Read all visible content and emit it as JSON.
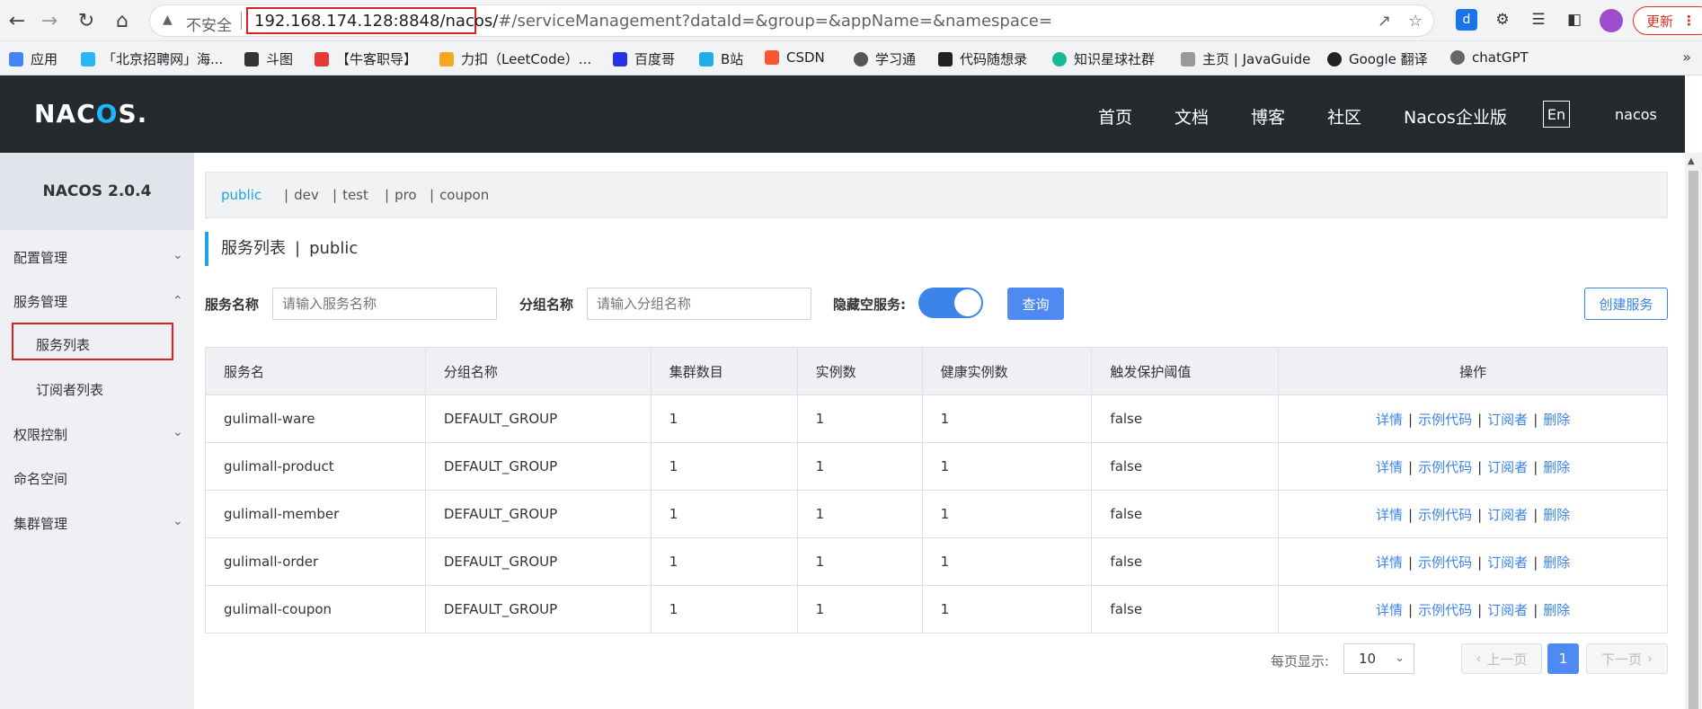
{
  "browser": {
    "insecure_label": "不安全",
    "url_highlight": "192.168.174.128:8848/nacos/",
    "url_rest": "#/serviceManagement?dataId=&group=&appName=&namespace=",
    "update_label": "更新",
    "bookmarks": [
      {
        "label": "应用",
        "color": "#4285f4"
      },
      {
        "label": "「北京招聘网」海...",
        "color": "#29b6f6"
      },
      {
        "label": "斗图",
        "color": "#333333"
      },
      {
        "label": "【牛客职导】",
        "color": "#e53935"
      },
      {
        "label": "力扣（LeetCode）...",
        "color": "#f5a623"
      },
      {
        "label": "百度哥",
        "color": "#2932e1"
      },
      {
        "label": "B站",
        "color": "#23ade5"
      },
      {
        "label": "CSDN",
        "color": "#fc5531"
      },
      {
        "label": "学习通",
        "color": "#555555"
      },
      {
        "label": "代码随想录",
        "color": "#222222"
      },
      {
        "label": "知识星球社群",
        "color": "#16b998"
      },
      {
        "label": "主页 | JavaGuide",
        "color": "#999999"
      },
      {
        "label": "Google 翻译",
        "color": "#222222"
      },
      {
        "label": "chatGPT",
        "color": "#666666"
      }
    ]
  },
  "header": {
    "logo": "NACOS.",
    "nav": [
      "首页",
      "文档",
      "博客",
      "社区",
      "Nacos企业版"
    ],
    "lang": "En",
    "user": "nacos"
  },
  "sidebar": {
    "version": "NACOS 2.0.4",
    "items": [
      {
        "label": "配置管理"
      },
      {
        "label": "服务管理"
      },
      {
        "label": "服务列表"
      },
      {
        "label": "订阅者列表"
      },
      {
        "label": "权限控制"
      },
      {
        "label": "命名空间"
      },
      {
        "label": "集群管理"
      }
    ]
  },
  "namespaces": [
    "public",
    "dev",
    "test",
    "pro",
    "coupon"
  ],
  "page": {
    "title": "服务列表",
    "title_sep": "|",
    "namespace": "public"
  },
  "filters": {
    "service_label": "服务名称",
    "service_placeholder": "请输入服务名称",
    "group_label": "分组名称",
    "group_placeholder": "请输入分组名称",
    "hide_empty_label": "隐藏空服务:",
    "query_label": "查询",
    "create_label": "创建服务"
  },
  "table": {
    "columns": [
      "服务名",
      "分组名称",
      "集群数目",
      "实例数",
      "健康实例数",
      "触发保护阈值",
      "操作"
    ],
    "rows": [
      [
        "gulimall-ware",
        "DEFAULT_GROUP",
        "1",
        "1",
        "1",
        "false"
      ],
      [
        "gulimall-product",
        "DEFAULT_GROUP",
        "1",
        "1",
        "1",
        "false"
      ],
      [
        "gulimall-member",
        "DEFAULT_GROUP",
        "1",
        "1",
        "1",
        "false"
      ],
      [
        "gulimall-order",
        "DEFAULT_GROUP",
        "1",
        "1",
        "1",
        "false"
      ],
      [
        "gulimall-coupon",
        "DEFAULT_GROUP",
        "1",
        "1",
        "1",
        "false"
      ]
    ],
    "ops": [
      "详情",
      "示例代码",
      "订阅者",
      "删除"
    ]
  },
  "pagination": {
    "page_size_label": "每页显示:",
    "page_size": "10",
    "prev": "上一页",
    "current": "1",
    "next": "下一页"
  }
}
